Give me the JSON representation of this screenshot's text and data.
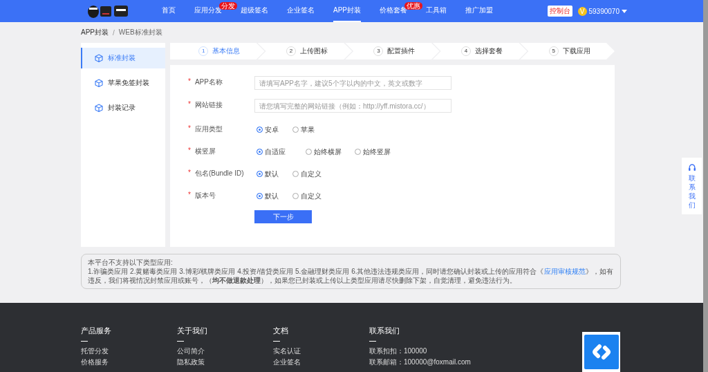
{
  "header": {
    "nav": [
      {
        "label": "首页",
        "selected": false
      },
      {
        "label": "应用分发",
        "selected": false,
        "badge": "分发"
      },
      {
        "label": "超级签名",
        "selected": false
      },
      {
        "label": "企业签名",
        "selected": false
      },
      {
        "label": "APP封装",
        "selected": true
      },
      {
        "label": "价格套餐",
        "selected": false,
        "badge": "优惠"
      },
      {
        "label": "工具箱",
        "selected": false
      },
      {
        "label": "推广加盟",
        "selected": false
      }
    ],
    "console_button": "控制台",
    "vip_badge": "V",
    "account": "59390070"
  },
  "breadcrumb": {
    "items": [
      "APP封装",
      "WEB标准封装"
    ],
    "separator": "/"
  },
  "sidebar": {
    "items": [
      {
        "label": "标准封装",
        "selected": true
      },
      {
        "label": "苹果免签封装",
        "selected": false
      },
      {
        "label": "封装记录",
        "selected": false
      }
    ]
  },
  "steps": [
    {
      "number": "1",
      "label": "基本信息",
      "selected": true
    },
    {
      "number": "2",
      "label": "上传图标",
      "selected": false
    },
    {
      "number": "3",
      "label": "配置插件",
      "selected": false
    },
    {
      "number": "4",
      "label": "选择套餐",
      "selected": false
    },
    {
      "number": "5",
      "label": "下载应用",
      "selected": false
    }
  ],
  "form": {
    "fields": [
      {
        "kind": "input",
        "label": "APP名称",
        "required_mark": "*",
        "placeholder": "请填写APP名字，建议5个字以内的中文，英文或数字"
      },
      {
        "kind": "input",
        "label": "网站链接",
        "required_mark": "*",
        "placeholder": "请您填写完整的网站链接（例如：http://yff.mistora.cc/）"
      },
      {
        "kind": "radio",
        "label": "应用类型",
        "required_mark": "*",
        "options": [
          {
            "label": "安卓",
            "selected": true
          },
          {
            "label": "苹果",
            "selected": false
          }
        ]
      },
      {
        "kind": "radio",
        "label": "横竖屏",
        "required_mark": "*",
        "options": [
          {
            "label": "自适应",
            "selected": true
          },
          {
            "label": "始终横屏",
            "selected": false
          },
          {
            "label": "始终竖屏",
            "selected": false
          }
        ]
      },
      {
        "kind": "radio",
        "label": "包名(Bundle ID)",
        "required_mark": "*",
        "options": [
          {
            "label": "默认",
            "selected": true
          },
          {
            "label": "自定义",
            "selected": false
          }
        ]
      },
      {
        "kind": "radio",
        "label": "版本号",
        "required_mark": "*",
        "options": [
          {
            "label": "默认",
            "selected": true
          },
          {
            "label": "自定义",
            "selected": false
          }
        ]
      }
    ],
    "submit": "下一步"
  },
  "notice": {
    "title": "本平台不支持以下类型应用:",
    "text_before": "1.诈骗类应用 2.黄赌毒类应用 3.博彩/棋牌类应用 4.投资/借贷类应用 5.金融理财类应用 6.其他违法违规类应用，同时请您确认封装或上传的应用符合《",
    "link": "应用审核规范",
    "text_after": "》，如有违反，我们将视情况封禁应用或账号，（**均不做退款处理**），如果您已封装或上传以上类型应用请尽快删除下架，自觉清理，避免违法行为。"
  },
  "contact_widget": "联系我们",
  "footer": {
    "columns": [
      {
        "title": "产品服务",
        "links": [
          "托管分发",
          "价格服务"
        ]
      },
      {
        "title": "关于我们",
        "links": [
          "公司简介",
          "隐私政策"
        ]
      },
      {
        "title": "文档",
        "links": [
          "实名认证",
          "企业签名"
        ]
      },
      {
        "title": "联系我们",
        "links": [
          "联系扣扣：100000",
          "联系邮箱：100000@foxmail.com"
        ]
      }
    ]
  }
}
